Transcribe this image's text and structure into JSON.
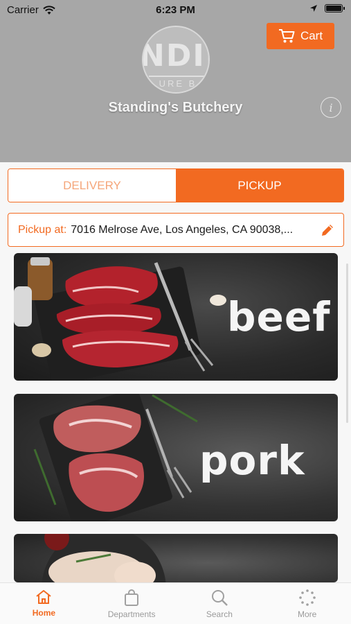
{
  "status_bar": {
    "carrier": "Carrier",
    "time": "6:23 PM"
  },
  "header": {
    "cart_label": "Cart",
    "logo_text": "NDII",
    "logo_subtext": "URE B",
    "store_name": "Standing's Butchery"
  },
  "mode_tabs": [
    {
      "label": "DELIVERY",
      "selected": false
    },
    {
      "label": "PICKUP",
      "selected": true
    }
  ],
  "pickup": {
    "label": "Pickup at:",
    "address": "7016 Melrose Ave, Los Angeles, CA 90038,..."
  },
  "categories": [
    {
      "label": "beef"
    },
    {
      "label": "pork"
    },
    {
      "label": ""
    }
  ],
  "bottom_nav": [
    {
      "label": "Home",
      "icon": "home-icon",
      "active": true
    },
    {
      "label": "Departments",
      "icon": "shopping-bag-icon",
      "active": false
    },
    {
      "label": "Search",
      "icon": "search-icon",
      "active": false
    },
    {
      "label": "More",
      "icon": "more-dots-icon",
      "active": false
    }
  ],
  "colors": {
    "accent": "#f26a21",
    "header_bg": "#a7a7a7"
  }
}
